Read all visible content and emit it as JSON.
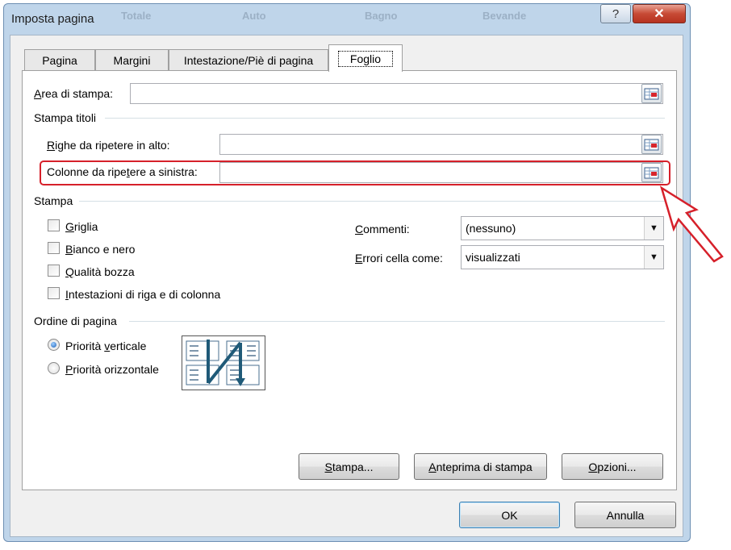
{
  "window": {
    "title": "Imposta pagina",
    "background_blur": [
      "Totale",
      "Auto",
      "Bagno",
      "Bevande"
    ],
    "help_glyph": "?",
    "close_glyph": "✕"
  },
  "tabs": [
    {
      "label": "Pagina"
    },
    {
      "label": "Margini"
    },
    {
      "label": "Intestazione/Piè di pagina"
    },
    {
      "label": "Foglio",
      "active": true
    }
  ],
  "print_area": {
    "label_accel": "A",
    "label_rest": "rea di stampa:",
    "value": ""
  },
  "print_titles": {
    "section_label": "Stampa titoli",
    "rows": {
      "label_accel": "R",
      "label_rest": "ighe da ripetere in alto:",
      "value": ""
    },
    "columns": {
      "label_pre": "Colonne da ripe",
      "label_accel": "t",
      "label_rest": "ere a sinistra:",
      "value": "",
      "highlighted": true
    }
  },
  "print": {
    "section_label": "Stampa",
    "checkboxes": [
      {
        "accel": "G",
        "rest": "riglia",
        "checked": false
      },
      {
        "accel": "B",
        "rest": "ianco e nero",
        "checked": false
      },
      {
        "accel": "Q",
        "rest": "ualità bozza",
        "checked": false
      },
      {
        "accel": "I",
        "rest": "ntestazioni di riga e di colonna",
        "checked": false
      }
    ],
    "comments": {
      "label_accel": "C",
      "label_rest": "ommenti:",
      "value": "(nessuno)"
    },
    "errors": {
      "label_accel": "E",
      "label_rest": "rrori cella come:",
      "value": "visualizzati"
    }
  },
  "page_order": {
    "section_label": "Ordine di pagina",
    "options": [
      {
        "pre": "Priorità ",
        "accel": "v",
        "rest": "erticale",
        "selected": true
      },
      {
        "pre": "",
        "accel": "P",
        "rest": "riorità orizzontale",
        "selected": false
      }
    ]
  },
  "actions": {
    "print": {
      "accel": "S",
      "rest": "tampa..."
    },
    "preview": {
      "accel": "A",
      "rest": "nteprima di stampa"
    },
    "options": {
      "accel": "O",
      "rest": "pzioni..."
    }
  },
  "footer": {
    "ok": "OK",
    "cancel": "Annulla"
  },
  "colors": {
    "highlight": "#d6202a",
    "window_frame": "#bfd5ea",
    "close_button": "#c74a35"
  },
  "icons": [
    "collapse-dialog-icon",
    "dropdown-arrow-icon",
    "annotation-arrow-icon",
    "page-order-preview-icon"
  ]
}
